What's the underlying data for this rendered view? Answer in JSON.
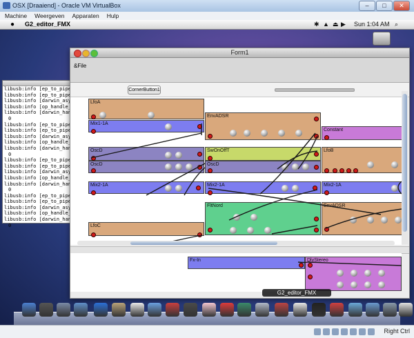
{
  "vbox": {
    "title": "OSX [Draaiend] - Oracle VM VirtualBox",
    "menu": [
      "Machine",
      "Weergeven",
      "Apparaten",
      "Hulp"
    ],
    "host_key": "Right Ctrl"
  },
  "mac": {
    "apple": "",
    "app_name": "G2_editor_FMX",
    "clock": "Sun 1:04 AM"
  },
  "terminal": {
    "lines": [
      "libusb:info [ep_to_pipe",
      "libusb:info [ep_to_pipe",
      "libusb:info [darwin_asy",
      "libusb:info [op_handle_",
      "libusb:info [darwin_han",
      "0",
      "libusb:info [ep_to_pipe",
      "libusb:info [ep_to_pipe",
      "libusb:info [darwin_asy",
      "libusb:info [op_handle_",
      "libusb:info [darwin_han",
      "0",
      "libusb:info [ep_to_pipe",
      "libusb:info [ep_to_pipe",
      "libusb:info [darwin_asy",
      "libusb:info [op_handle_",
      "libusb:info [darwin_han",
      "0",
      "libusb:info [ep_to_pipe",
      "libusb:info [ep_to_pipe",
      "libusb:info [darwin_asy",
      "libusb:info [op_handle_",
      "libusb:info [darwin_han",
      "0"
    ]
  },
  "form1": {
    "title": "Form1",
    "menu_file": "&File",
    "corner_button": "CornerButton1"
  },
  "modules": [
    {
      "label": "LfoA",
      "color": "#d9a87c"
    },
    {
      "label": "Mix1-1A",
      "color": "#7d7df0"
    },
    {
      "label": "EnvADSR",
      "color": "#d9a87c"
    },
    {
      "label": "Constant",
      "color": "#c87ad8"
    },
    {
      "label": "OscD",
      "color": "#8c84c2"
    },
    {
      "label": "OscD",
      "color": "#8c84c2"
    },
    {
      "label": "SwOnOffT",
      "color": "#c7d96a"
    },
    {
      "label": "OscD",
      "color": "#8c84c2"
    },
    {
      "label": "LfoB",
      "color": "#d9a87c"
    },
    {
      "label": "Mix2-1A",
      "color": "#7d7df0"
    },
    {
      "label": "Mix2-1A",
      "color": "#7d7df0"
    },
    {
      "label": "Mix2-1A",
      "color": "#7d7df0"
    },
    {
      "label": "FltNord",
      "color": "#5fd08e"
    },
    {
      "label": "EnvADSR",
      "color": "#d9a87c"
    },
    {
      "label": "LfoC",
      "color": "#d9a87c"
    },
    {
      "label": "Fx-In",
      "color": "#7d7df0"
    },
    {
      "label": "DlyStereo",
      "color": "#c87ad8"
    }
  ],
  "caption": "G2_editor_FMX",
  "colors": {
    "cable": "#1a1a1a",
    "jack": "#d21919"
  }
}
